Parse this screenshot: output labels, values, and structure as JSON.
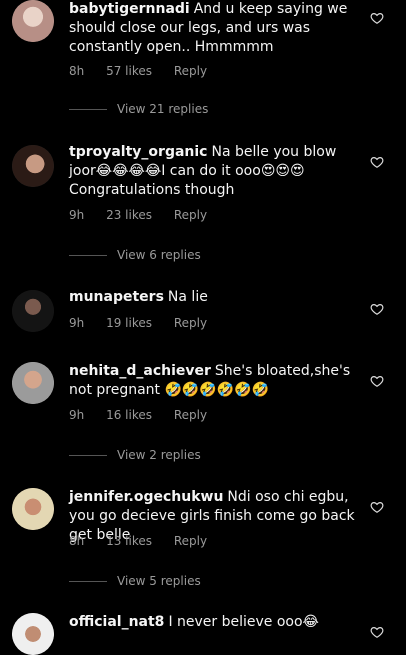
{
  "comments": [
    {
      "username": "babytigernnadi",
      "text": "And u keep saying we should close our legs, and urs was constantly open.. Hmmmmm",
      "time": "8h",
      "likes": "57 likes",
      "reply": "Reply",
      "view_replies": "View 21 replies"
    },
    {
      "username": "tproyalty_organic",
      "text": "Na belle you blow joor😂😂😂😂I can do it ooo😍😍😍 Congratulations though",
      "time": "9h",
      "likes": "23 likes",
      "reply": "Reply",
      "view_replies": "View 6 replies"
    },
    {
      "username": "munapeters",
      "text": "Na lie",
      "time": "9h",
      "likes": "19 likes",
      "reply": "Reply"
    },
    {
      "username": "nehita_d_achiever",
      "text": "She's bloated,she's not pregnant 🤣🤣🤣🤣🤣🤣",
      "time": "9h",
      "likes": "16 likes",
      "reply": "Reply",
      "view_replies": "View 2 replies"
    },
    {
      "username": "jennifer.ogechukwu",
      "text": "Ndi oso chi egbu, you go decieve girls finish come go back get belle",
      "time": "8h",
      "likes": "13 likes",
      "reply": "Reply",
      "view_replies": "View 5 replies"
    },
    {
      "username": "official_nat8",
      "text": "I never believe ooo😂"
    }
  ],
  "icons": {
    "like": "heart-outline-icon"
  },
  "colors": {
    "background": "#000000",
    "meta": "#9a9a9a"
  }
}
